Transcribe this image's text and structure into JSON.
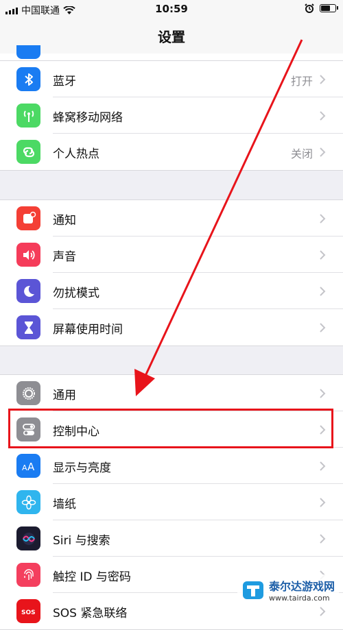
{
  "status_bar": {
    "carrier": "中国联通",
    "time": "10:59"
  },
  "nav": {
    "title": "设置"
  },
  "groups": [
    {
      "items": [
        {
          "label": "蓝牙",
          "value": "打开",
          "icon": "bluetooth-icon",
          "color": "#1a7cf2"
        },
        {
          "label": "蜂窝移动网络",
          "value": "",
          "icon": "cellular-icon",
          "color": "#4cd964"
        },
        {
          "label": "个人热点",
          "value": "关闭",
          "icon": "hotspot-icon",
          "color": "#4cd964"
        }
      ]
    },
    {
      "items": [
        {
          "label": "通知",
          "value": "",
          "icon": "notifications-icon",
          "color": "#f43f35"
        },
        {
          "label": "声音",
          "value": "",
          "icon": "sound-icon",
          "color": "#f53c5a"
        },
        {
          "label": "勿扰模式",
          "value": "",
          "icon": "moon-icon",
          "color": "#5b55d6"
        },
        {
          "label": "屏幕使用时间",
          "value": "",
          "icon": "hourglass-icon",
          "color": "#5b55d6"
        }
      ]
    },
    {
      "items": [
        {
          "label": "通用",
          "value": "",
          "icon": "gear-icon",
          "color": "#8e8e93"
        },
        {
          "label": "控制中心",
          "value": "",
          "icon": "toggles-icon",
          "color": "#8e8e93"
        },
        {
          "label": "显示与亮度",
          "value": "",
          "icon": "display-icon",
          "color": "#1a7cf2"
        },
        {
          "label": "墙纸",
          "value": "",
          "icon": "flower-icon",
          "color": "#2fb5ee"
        },
        {
          "label": "Siri 与搜索",
          "value": "",
          "icon": "siri-icon",
          "color": "#1b1b2f"
        },
        {
          "label": "触控 ID 与密码",
          "value": "",
          "icon": "fingerprint-icon",
          "color": "#f43f5e"
        },
        {
          "label": "SOS 紧急联络",
          "value": "",
          "icon": "sos-icon",
          "color": "#e8141b"
        }
      ]
    }
  ],
  "annotation": {
    "color": "#e8141b"
  },
  "watermark": {
    "name": "泰尔达游戏网",
    "url": "www.tairda.com"
  }
}
